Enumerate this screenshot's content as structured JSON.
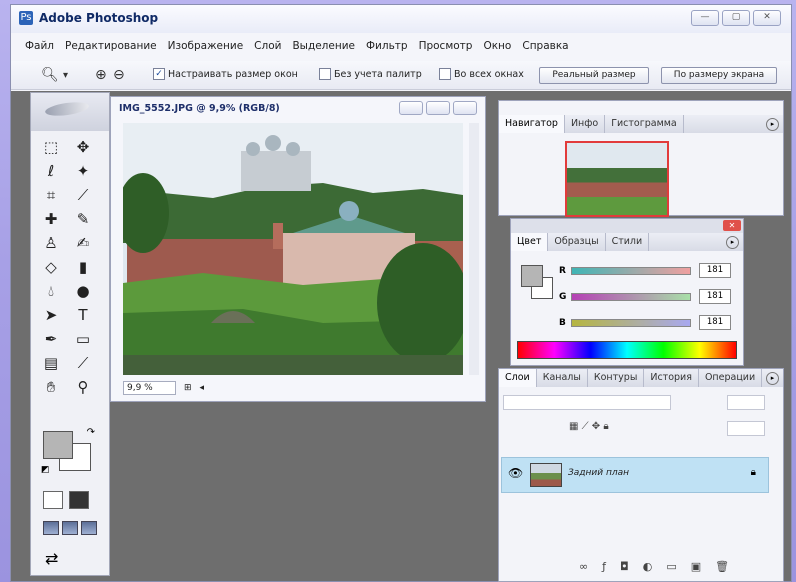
{
  "app": {
    "title": "Adobe Photoshop"
  },
  "menu": [
    "Файл",
    "Редактирование",
    "Изображение",
    "Слой",
    "Выделение",
    "Фильтр",
    "Просмотр",
    "Окно",
    "Справка"
  ],
  "options": {
    "resize_windows": "Настраивать размер окон",
    "ignore_palettes": "Без учета палитр",
    "all_windows": "Во всех окнах",
    "actual_pixels": "Реальный размер",
    "fit_screen": "По размеру экрана"
  },
  "document": {
    "title": "IMG_5552.JPG @ 9,9% (RGB/8)",
    "zoom": "9,9 %"
  },
  "navigator": {
    "tabs": [
      "Навигатор",
      "Инфо",
      "Гистограмма"
    ]
  },
  "color_panel": {
    "tabs": [
      "Цвет",
      "Образцы",
      "Стили"
    ],
    "channels": [
      {
        "label": "R",
        "value": "181"
      },
      {
        "label": "G",
        "value": "181"
      },
      {
        "label": "B",
        "value": "181"
      }
    ],
    "foreground": "#b5b5b5"
  },
  "layers_panel": {
    "tabs": [
      "Слои",
      "Каналы",
      "Контуры",
      "История",
      "Операции"
    ],
    "layer_name": "Задний план"
  }
}
